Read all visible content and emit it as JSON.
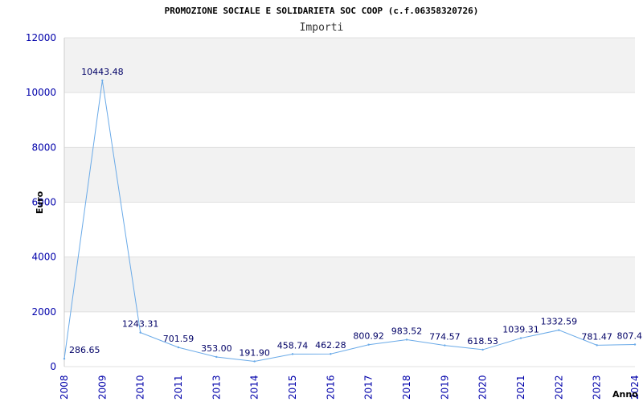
{
  "chart_data": {
    "type": "line",
    "title": "PROMOZIONE SOCIALE E SOLIDARIETA SOC COOP (c.f.06358320726)",
    "subtitle": "Importi",
    "xlabel": "Anno",
    "ylabel": "Euro",
    "categories": [
      "2008",
      "2009",
      "2010",
      "2011",
      "2013",
      "2014",
      "2015",
      "2016",
      "2017",
      "2018",
      "2019",
      "2020",
      "2021",
      "2022",
      "2023",
      "2024"
    ],
    "series": [
      {
        "values": [
          286.65,
          10443.48,
          1243.31,
          701.59,
          353.0,
          191.9,
          458.74,
          462.28,
          800.92,
          983.52,
          774.57,
          618.53,
          1039.31,
          1332.59,
          781.47,
          807.4
        ],
        "labels": [
          "286.65",
          "10443.48",
          "1243.31",
          "701.59",
          "353.00",
          "191.90",
          "458.74",
          "462.28",
          "800.92",
          "983.52",
          "774.57",
          "618.53",
          "1039.31",
          "1332.59",
          "781.47",
          "807.4"
        ]
      }
    ],
    "ylim": [
      0,
      12000
    ],
    "yticks": [
      0,
      2000,
      4000,
      6000,
      8000,
      10000,
      12000
    ],
    "grid": "horizontal alternating bands",
    "colors": {
      "line": "#6aaae8",
      "band": "#f2f2f2",
      "tick_text": "#0000aa",
      "data_label": "#000066"
    }
  }
}
